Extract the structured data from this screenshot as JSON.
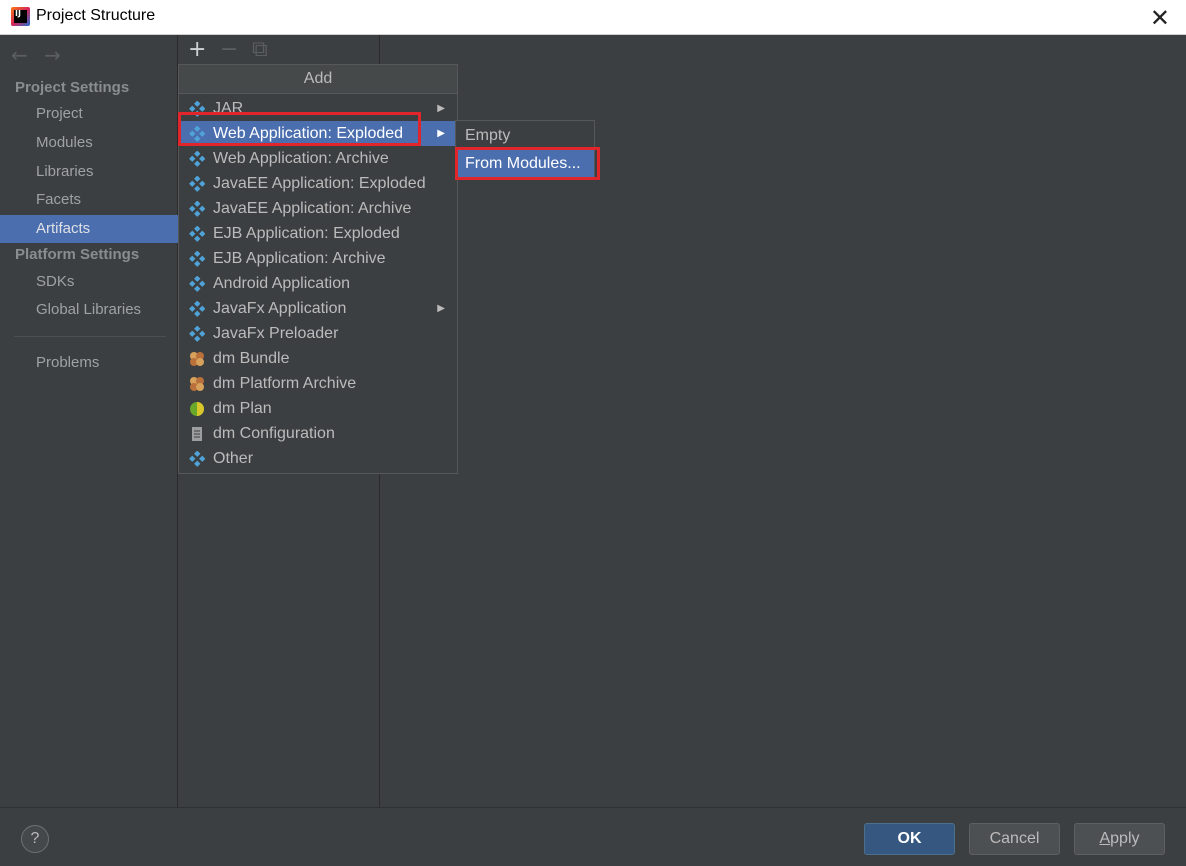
{
  "window": {
    "title": "Project Structure",
    "close_glyph": "✕"
  },
  "nav": {
    "back_glyph": "←",
    "forward_glyph": "→",
    "project_settings_header": "Project Settings",
    "project_items": [
      "Project",
      "Modules",
      "Libraries",
      "Facets",
      "Artifacts"
    ],
    "platform_settings_header": "Platform Settings",
    "platform_items": [
      "SDKs",
      "Global Libraries"
    ],
    "problems": "Problems",
    "selected": "Artifacts"
  },
  "toolbar": {
    "add_glyph": "+",
    "remove_glyph": "−",
    "copy_glyph": "⧉"
  },
  "add_menu": {
    "header": "Add",
    "items": [
      {
        "label": "JAR",
        "icon": "artifact-diamond-icon",
        "has_submenu": true
      },
      {
        "label": "Web Application: Exploded",
        "icon": "web-artifact-icon",
        "has_submenu": true,
        "highlighted": true
      },
      {
        "label": "Web Application: Archive",
        "icon": "web-archive-icon",
        "has_submenu": false
      },
      {
        "label": "JavaEE Application: Exploded",
        "icon": "javaee-artifact-icon",
        "has_submenu": false
      },
      {
        "label": "JavaEE Application: Archive",
        "icon": "javaee-archive-icon",
        "has_submenu": false
      },
      {
        "label": "EJB Application: Exploded",
        "icon": "ejb-artifact-icon",
        "has_submenu": false
      },
      {
        "label": "EJB Application: Archive",
        "icon": "ejb-archive-icon",
        "has_submenu": false
      },
      {
        "label": "Android Application",
        "icon": "artifact-diamond-icon",
        "has_submenu": false
      },
      {
        "label": "JavaFx Application",
        "icon": "artifact-diamond-icon",
        "has_submenu": true
      },
      {
        "label": "JavaFx Preloader",
        "icon": "artifact-diamond-icon",
        "has_submenu": false
      },
      {
        "label": "dm Bundle",
        "icon": "dm-bundle-icon",
        "has_submenu": false
      },
      {
        "label": "dm Platform Archive",
        "icon": "dm-platform-archive-icon",
        "has_submenu": false
      },
      {
        "label": "dm Plan",
        "icon": "dm-plan-icon",
        "has_submenu": false
      },
      {
        "label": "dm Configuration",
        "icon": "dm-configuration-icon",
        "has_submenu": false
      },
      {
        "label": "Other",
        "icon": "artifact-diamond-icon",
        "has_submenu": false
      }
    ],
    "submenu_glyph": "▶"
  },
  "submenu": {
    "items": [
      {
        "label": "Empty",
        "highlighted": false
      },
      {
        "label": "From Modules...",
        "highlighted": true
      }
    ]
  },
  "buttons": {
    "help": "?",
    "ok": "OK",
    "cancel": "Cancel",
    "apply_first": "A",
    "apply_rest": "pply"
  },
  "colors": {
    "selection": "#4b6eaf",
    "background": "#3c3f41",
    "annotation": "#e0262b",
    "artifact_icon": "#4fa3d8"
  }
}
